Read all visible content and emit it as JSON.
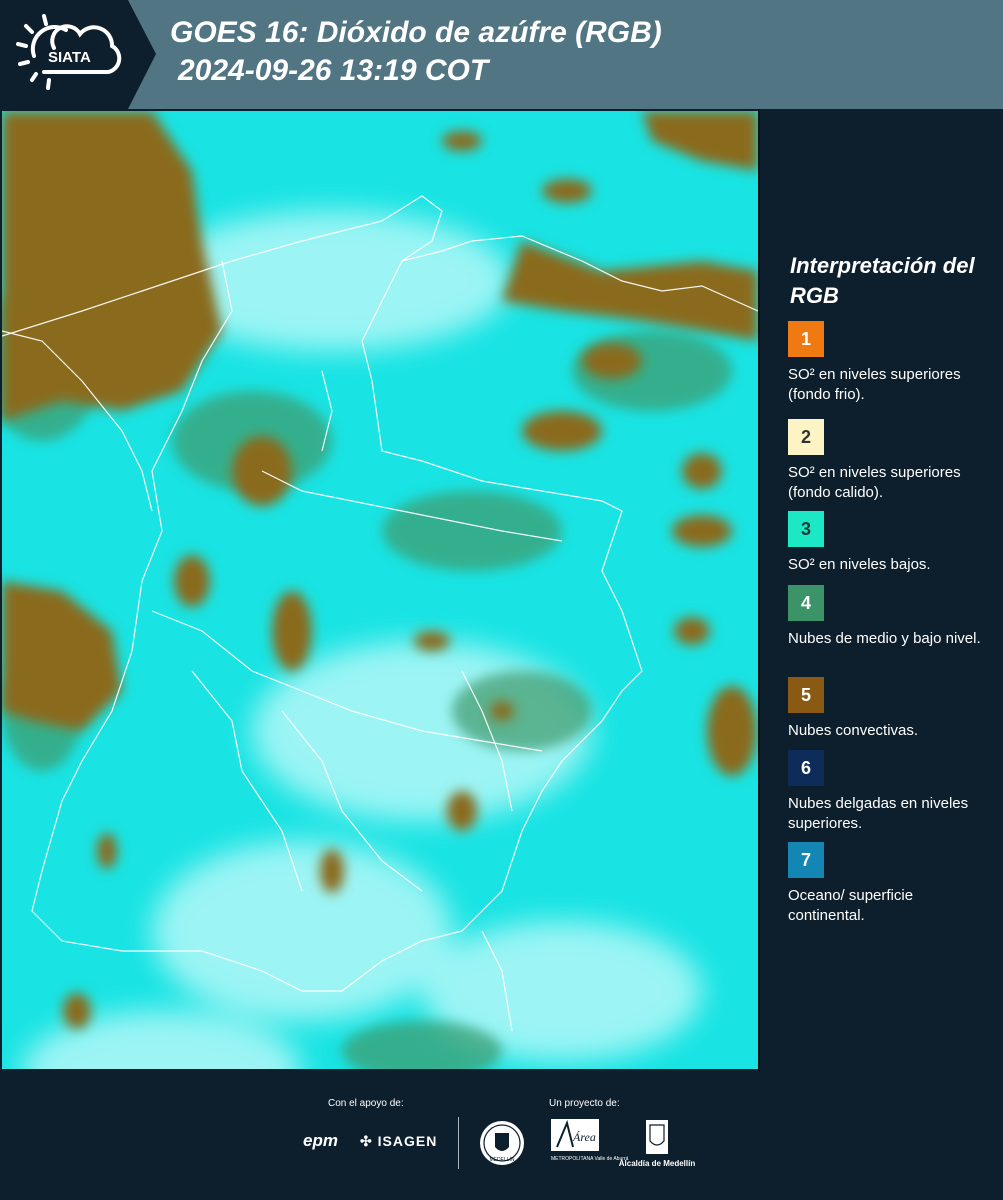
{
  "header": {
    "logo_text": "SIATA",
    "title_line1": "GOES 16: Dióxido de azúfre (RGB)",
    "title_line2": "2024-09-26 13:19 COT"
  },
  "legend": {
    "title": "Interpretación del RGB",
    "items": [
      {
        "num": "1",
        "color": "#f07a12",
        "num_color": "#ffffff",
        "label": "SO² en niveles superiores (fondo frio)."
      },
      {
        "num": "2",
        "color": "#fcf4c4",
        "num_color": "#333333",
        "label": "SO² en niveles superiores (fondo calido)."
      },
      {
        "num": "3",
        "color": "#1de8c6",
        "num_color": "#1a3a3a",
        "label": "SO² en niveles bajos."
      },
      {
        "num": "4",
        "color": "#3a9468",
        "num_color": "#ffffff",
        "label": "Nubes de medio y bajo nivel."
      },
      {
        "num": "5",
        "color": "#8a5a14",
        "num_color": "#ffffff",
        "label": "Nubes convectivas."
      },
      {
        "num": "6",
        "color": "#0e2c5a",
        "num_color": "#ffffff",
        "label": "Nubes delgadas en niveles superiores."
      },
      {
        "num": "7",
        "color": "#1386b4",
        "num_color": "#ffffff",
        "label": "Oceano/ superficie continental."
      }
    ]
  },
  "footer": {
    "support_label": "Con el apoyo de:",
    "project_label": "Un proyecto de:",
    "support_logos": [
      "epm",
      "ISAGEN"
    ],
    "project_logos": [
      "METROPOLITANA Valle de Aburrá",
      "Alcaldía de Medellín"
    ],
    "area_logo_text": "Área",
    "medellin_seal_text": "MEDELLÍN"
  },
  "map": {
    "background_color": "#19e3e3",
    "cloud_color": "#8a6a1e",
    "boundary_color": "#ffffff"
  }
}
